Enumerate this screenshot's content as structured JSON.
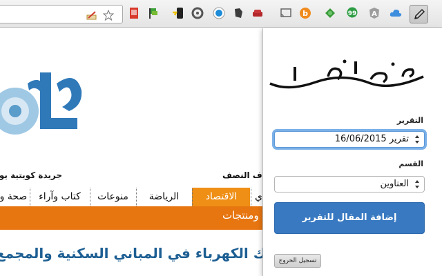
{
  "toolbar": {
    "extensions": [
      "pdf-icon",
      "flag-icon",
      "phone-charge-icon",
      "sync-icon",
      "skype-icon",
      "evernote-icon",
      "sofa-icon",
      "cast-icon",
      "b-icon",
      "leaf-icon",
      "chat-icon",
      "angular-icon",
      "cloud-icon",
      "pen-icon"
    ]
  },
  "site": {
    "tagline": "جريدة كويتية يومية",
    "date": "ف النصف",
    "nav": [
      "صحة و",
      "كتاب وآراء",
      "منوعات",
      "الرياضة",
      "الاقتصاد",
      "ي"
    ],
    "active_nav": "الاقتصاد",
    "subbar": "ومنتجات",
    "headline": "استهلاك الكهرباء في المباني السكنية والمجمع"
  },
  "popup": {
    "report_label": "التقرير",
    "report_value": "تقرير 16/06/2015",
    "section_label": "القسم",
    "section_value": "العناوين",
    "add_button": "إضافة المقال للتقرير",
    "logout_button": "تسجيل الخروج"
  },
  "colors": {
    "accent": "#3879c1",
    "site_orange": "#e77510",
    "site_orange_active": "#ef8f16",
    "headline": "#1d5f93"
  }
}
